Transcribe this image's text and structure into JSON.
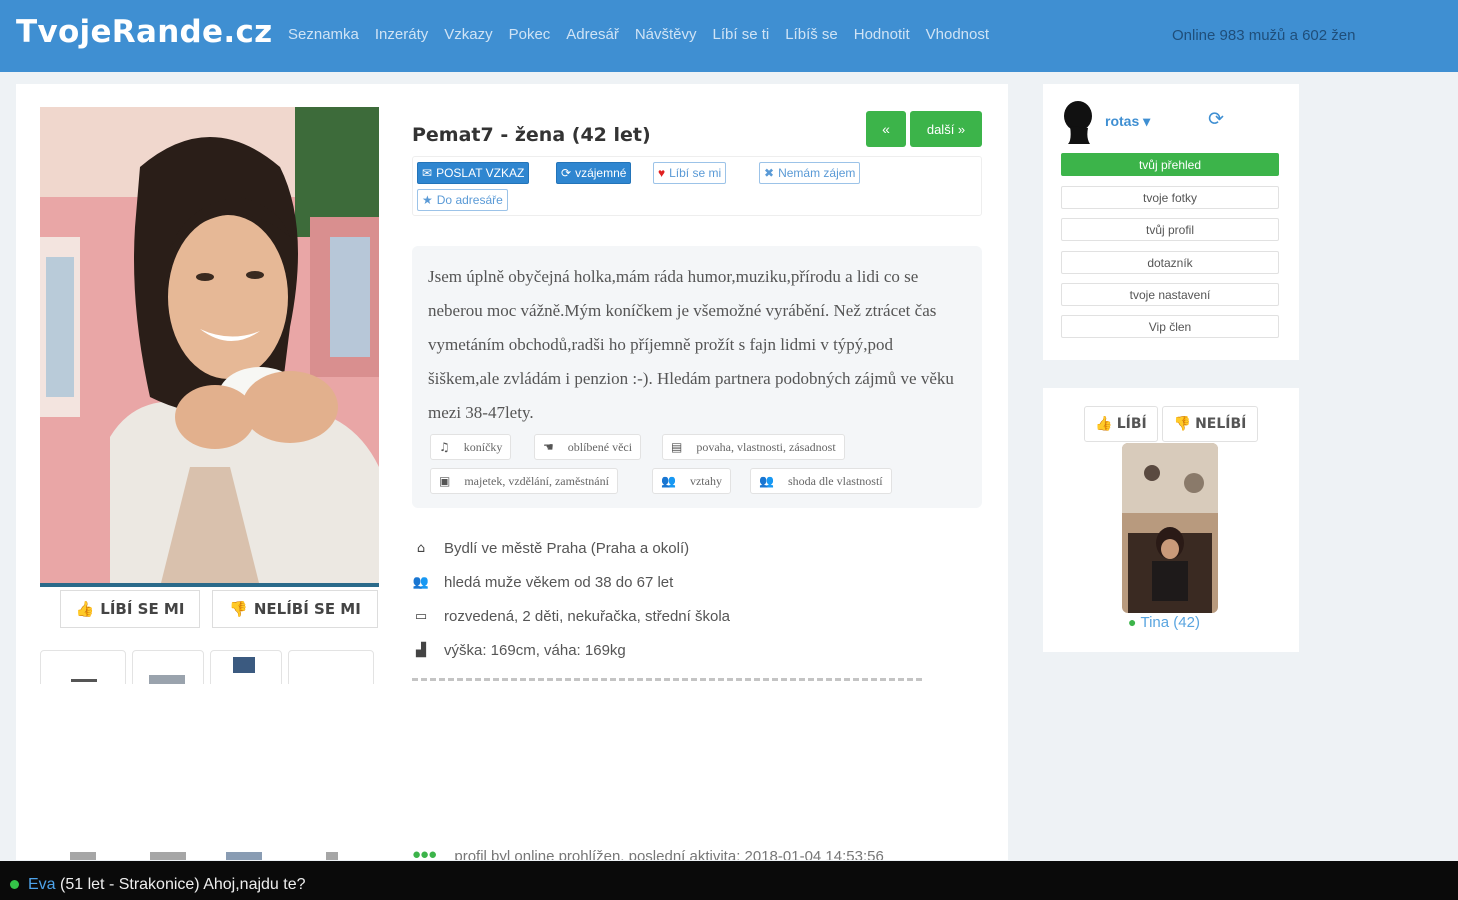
{
  "site": {
    "logo": "TvojeRande.cz"
  },
  "nav": {
    "items": [
      "Seznamka",
      "Inzeráty",
      "Vzkazy",
      "Pokec",
      "Adresář",
      "Návštěvy",
      "Líbí se ti",
      "Líbíš se",
      "Hodnotit",
      "Vhodnost"
    ],
    "online": "Online 983 mužů a 602 žen"
  },
  "profile": {
    "title": "Pemat7 - žena (42 let)",
    "prev_label": "«",
    "next_label": "další »",
    "like_label": "LÍBÍ SE MI",
    "dislike_label": "NELÍBÍ SE MI",
    "actions": {
      "send_message": "POSLAT VZKAZ",
      "mutual": "vzájemné",
      "like": "Líbí se mi",
      "no_interest": "Nemám zájem",
      "to_addressbook": "Do adresáře"
    },
    "about": "Jsem úplně obyčejná holka,mám ráda humor,muziku,přírodu a lidi co se neberou moc vážně.Mým koníčkem je všemožné vyrábění. Než ztrácet čas vymetáním obchodů,radši ho příjemně prožít s fajn lidmi v týpý,pod šiškem,ale zvládám i penzion :-). Hledám partnera podobných zájmů ve věku mezi 38-47lety.",
    "tags": [
      "koníčky",
      "oblíbené věci",
      "povaha, vlastnosti, zásadnost",
      "majetek, vzdělání, zaměstnání",
      "vztahy",
      "shoda dle vlastností"
    ],
    "info": {
      "city": "Bydlí ve městě Praha (Praha a okolí)",
      "looking_for": "hledá muže věkem od 38 do 67 let",
      "status": "rozvedená, 2 děti, nekuřačka, střední škola",
      "body": "výška: 169cm, váha: 169kg",
      "last_online": "profil byl online prohlížen, poslední aktivita: 2018-01-04 14:53:56"
    }
  },
  "user": {
    "name": "rotas ▾",
    "menu": [
      "tvůj přehled",
      "tvoje fotky",
      "tvůj profil",
      "dotazník",
      "tvoje nastavení",
      "Vip člen"
    ]
  },
  "match": {
    "like_label": "LÍBÍ",
    "dislike_label": "NELÍBÍ",
    "name": "Tina (42)"
  },
  "chat": {
    "name": "Eva",
    "message": " (51 let - Strakonice) Ahoj,najdu te?"
  },
  "icons": {
    "like": "thumb-up-icon",
    "dislike": "thumb-down-icon",
    "envelope": "envelope-icon",
    "refresh": "refresh-icon",
    "heart": "heart-icon",
    "close": "close-icon",
    "star": "star-icon",
    "home": "home-icon",
    "users": "users-icon",
    "calendar": "calendar-icon",
    "chart": "bar-chart-icon"
  },
  "colors": {
    "header": "#3f8fd2",
    "green": "#3cb44a",
    "chatbar": "#0a0a0a"
  }
}
